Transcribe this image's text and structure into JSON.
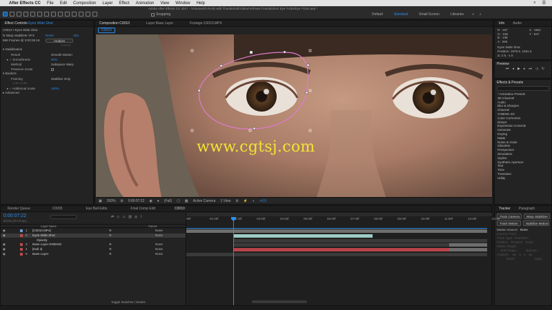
{
  "menubar": {
    "apple": "",
    "app": "After Effects CC",
    "items": [
      "File",
      "Edit",
      "Composition",
      "Layer",
      "Effect",
      "Animation",
      "View",
      "Window",
      "Help"
    ],
    "search_icon": "search-icon",
    "user_icon": "user-icon"
  },
  "toolbar": {
    "window_title": "Adobe After Effects CC 2017 - /Volumes/G-RAID with Thunderbolt/VideoFort/New Tutorials/042 Eye Tricks/Eye Tricks.aep *",
    "snapping": "Snapping",
    "workspaces": [
      "Default",
      "Standard",
      "Small Screen",
      "Libraries"
    ],
    "active_workspace": "Standard"
  },
  "effect_controls": {
    "tab_label": "Effect Controls",
    "tab_layer": "Eyes Wide Shut",
    "breadcrumb": "C0010 • Eyes Wide Shut",
    "rows": [
      {
        "label": "fx  Warp Stabilizer VFX",
        "reset": "Reset",
        "about": "Abo"
      },
      {
        "label": "596 Frames @ 0:00:26:16",
        "button": "Analyze"
      },
      {
        "button": "Cancel"
      },
      {
        "label": "▾ Stabilization"
      },
      {
        "label": "Result",
        "value": "Smooth Motion"
      },
      {
        "label": "▸ ♂ Smoothness",
        "value": "50%"
      },
      {
        "label": "Method",
        "value": "Subspace Warp"
      },
      {
        "label": "Preserve Scale"
      },
      {
        "label": "▾ Borders"
      },
      {
        "label": "Framing",
        "value": "Stabilize Only"
      },
      {
        "label": "Auto-scale"
      },
      {
        "label": "▸ ♂ Additional Scale",
        "value": "100%"
      },
      {
        "label": "▸ Advanced"
      }
    ]
  },
  "comp_panel": {
    "tabs": [
      "Composition C0010",
      "Layer Base Layer",
      "Footage C0010.MP4"
    ],
    "breadcrumb": "C0010"
  },
  "viewer": {
    "watermark": "www.cgtsj.com"
  },
  "viewer_bar": {
    "zoom": "200%",
    "timecode": "0:00:07:22",
    "resolution": "(Full)",
    "camera": "Active Camera",
    "views": "1 View",
    "offset": "+0.0"
  },
  "info": {
    "tabs": [
      "Info",
      "Audio"
    ],
    "r": "R : 167",
    "g": "G : 155",
    "b": "B : 138",
    "a": "A : 255",
    "x": "X : 1821",
    "y": "Y : 947",
    "layer": "Eyes Wide Shut",
    "position": "Position: 1879.5, 1051.5",
    "delta": "Δ: 2.5, -1.0"
  },
  "preview": {
    "title": "Preview"
  },
  "effects_presets": {
    "title": "Effects & Presets",
    "search_placeholder": "",
    "items": [
      "* Animation Presets",
      "3D Channel",
      "Audio",
      "Blur & Sharpen",
      "Channel",
      "CINEMA 4D",
      "Color Correction",
      "Distort",
      "Expression Controls",
      "Generate",
      "Keying",
      "Matte",
      "Noise & Grain",
      "Obsolete",
      "Perspective",
      "Simulation",
      "Stylize",
      "Synthetic Aperture",
      "Text",
      "Time",
      "Transition",
      "Utility"
    ]
  },
  "tracker": {
    "tabs": [
      "Tracker",
      "Paragraph"
    ],
    "buttons": [
      "Track Camera",
      "Warp Stabilizer",
      "Track Motion",
      "Stabilize Motion"
    ],
    "motion_source_label": "Motion Source:",
    "motion_source_value": "None",
    "current_track": "Current Track:",
    "track_type": "Track Type:",
    "track_type_value": "Transform",
    "checks": [
      "Position",
      "Rotation",
      "Scale"
    ],
    "motion_target": "Motion Target:",
    "edit_target": "Edit Target...",
    "options": "Options...",
    "analyze_label": "Analyze:",
    "reset": "Reset",
    "apply": "Apply"
  },
  "timeline": {
    "tabs": [
      "Render Queue",
      "C0005",
      "Eye Ball Edits",
      "Final Comp Edit",
      "C0010"
    ],
    "active_tab": "C0010",
    "timecode": "0:00:07:22",
    "frame_info": "00190 (23.976 fps)",
    "col_layer_name": "Layer Name",
    "col_parent": "Parent",
    "ruler": [
      "00f",
      "01:00f",
      "02:00f",
      "03:00f",
      "04:00f",
      "05:00f",
      "06:00f",
      "07:00f",
      "08:00f",
      "09:00f",
      "10:00f",
      "11:00f",
      "12:00f",
      "13:00f"
    ],
    "layers": [
      {
        "num": "1",
        "name": "[C0010.MP4]",
        "label_color": "#6a9bd1",
        "parent": "None"
      },
      {
        "num": "2",
        "name": "Eyes Wide Shut",
        "label_color": "#c04b4b",
        "parent": "None",
        "selected": true
      },
      {
        "num": "",
        "name": "Opacity",
        "parent": ""
      },
      {
        "num": "3",
        "name": "Base Layer  ENDING",
        "label_color": "#c04b4b",
        "parent": "None"
      },
      {
        "num": "4",
        "name": "[Null 4]",
        "label_color": "#c04b4b",
        "parent": "None"
      },
      {
        "num": "5",
        "name": "Base Layer",
        "label_color": "#c04b4b",
        "parent": "None"
      }
    ],
    "footer": "Toggle Switches / Modes"
  },
  "colors": {
    "accent": "#2d8ceb",
    "mask": "#e07bd0",
    "watermark": "#f1e433",
    "track_teal": "#9ccbc4",
    "track_red": "#b8434b",
    "track_gray": "#6e6e6e"
  }
}
